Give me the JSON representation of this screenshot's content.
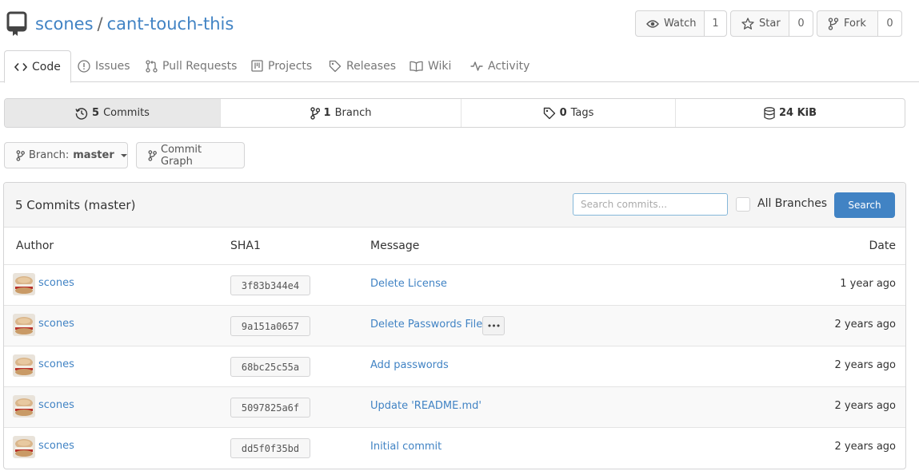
{
  "repo": {
    "owner": "scones",
    "name": "cant-touch-this"
  },
  "actions": [
    {
      "label": "Watch",
      "count": "1",
      "icon": "eye-icon"
    },
    {
      "label": "Star",
      "count": "0",
      "icon": "star-icon"
    },
    {
      "label": "Fork",
      "count": "0",
      "icon": "fork-icon"
    }
  ],
  "tabs": [
    {
      "label": "Code",
      "icon": "code-icon",
      "active": true
    },
    {
      "label": "Issues",
      "icon": "issue-icon"
    },
    {
      "label": "Pull Requests",
      "icon": "pull-request-icon"
    },
    {
      "label": "Projects",
      "icon": "project-icon"
    },
    {
      "label": "Releases",
      "icon": "tag-icon"
    },
    {
      "label": "Wiki",
      "icon": "book-icon"
    },
    {
      "label": "Activity",
      "icon": "pulse-icon"
    }
  ],
  "stats": {
    "commits": {
      "count": "5",
      "label": "Commits"
    },
    "branches": {
      "count": "1",
      "label": "Branch"
    },
    "tags": {
      "count": "0",
      "label": "Tags"
    },
    "size": {
      "value": "24 KiB"
    }
  },
  "branch": {
    "prefix": "Branch:",
    "name": "master"
  },
  "commit_graph_label": "Commit Graph",
  "commits_table": {
    "title": "5 Commits (master)",
    "search_placeholder": "Search commits...",
    "all_branches_label": "All Branches",
    "search_button": "Search",
    "columns": {
      "author": "Author",
      "sha": "SHA1",
      "message": "Message",
      "date": "Date"
    },
    "rows": [
      {
        "author": "scones",
        "sha": "3f83b344e4",
        "message": "Delete License",
        "date": "1 year ago",
        "has_more": false
      },
      {
        "author": "scones",
        "sha": "9a151a0657",
        "message": "Delete Passwords File",
        "date": "2 years ago",
        "has_more": true
      },
      {
        "author": "scones",
        "sha": "68bc25c55a",
        "message": "Add passwords",
        "date": "2 years ago",
        "has_more": false
      },
      {
        "author": "scones",
        "sha": "5097825a6f",
        "message": "Update 'README.md'",
        "date": "2 years ago",
        "has_more": false
      },
      {
        "author": "scones",
        "sha": "dd5f0f35bd",
        "message": "Initial commit",
        "date": "2 years ago",
        "has_more": false
      }
    ]
  },
  "colors": {
    "link": "#4183c4",
    "primary_button": "#4183c4",
    "active_stat_bg": "#e8e8e8"
  }
}
